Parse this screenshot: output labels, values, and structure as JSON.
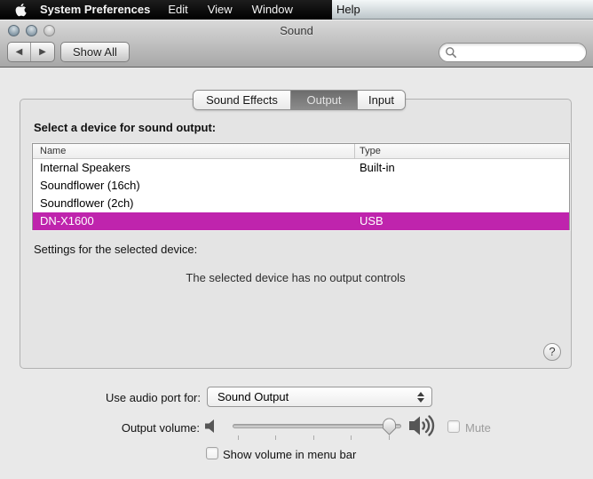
{
  "menu_bar": {
    "app_name": "System Preferences",
    "edit": "Edit",
    "view": "View",
    "window": "Window",
    "help": "Help"
  },
  "window": {
    "title": "Sound",
    "show_all_label": "Show All",
    "back_glyph": "◀",
    "forward_glyph": "▶",
    "search_placeholder": ""
  },
  "tabs": [
    {
      "label": "Sound Effects",
      "selected": false
    },
    {
      "label": "Output",
      "selected": true
    },
    {
      "label": "Input",
      "selected": false
    }
  ],
  "main": {
    "select_label": "Select a device for sound output:",
    "table": {
      "columns": [
        "Name",
        "Type"
      ],
      "rows": [
        {
          "name": "Internal Speakers",
          "type": "Built-in",
          "selected": false
        },
        {
          "name": "Soundflower (16ch)",
          "type": "",
          "selected": false
        },
        {
          "name": "Soundflower (2ch)",
          "type": "",
          "selected": false
        },
        {
          "name": "DN-X1600",
          "type": "USB",
          "selected": true
        }
      ]
    },
    "settings_label": "Settings for the selected device:",
    "no_controls_text": "The selected device has no output controls",
    "help_label": "?"
  },
  "footer": {
    "audio_port_label": "Use audio port for:",
    "audio_port_value": "Sound Output",
    "output_volume_label": "Output volume:",
    "volume_percent": 92,
    "mute_label": "Mute",
    "mute_checked": false,
    "show_volume_label": "Show volume in menu bar",
    "show_volume_checked": false
  },
  "colors": {
    "selection_highlight": "#bf24ad",
    "menu_bar_left": "#000000",
    "window_chrome": "#c0c0c0"
  }
}
